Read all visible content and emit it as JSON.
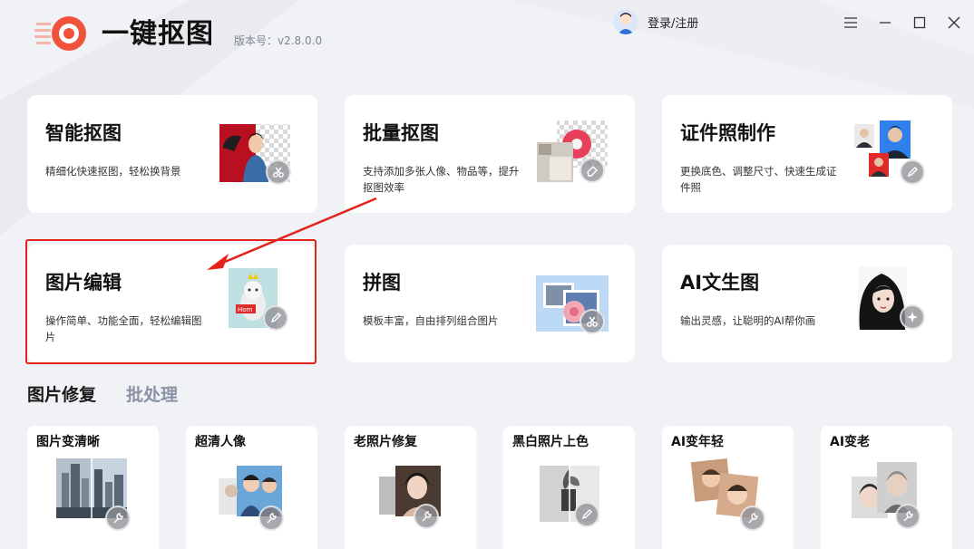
{
  "header": {
    "app_title": "一键抠图",
    "version": "版本号：v2.8.0.0",
    "login_label": "登录/注册",
    "window_controls": [
      "menu-icon",
      "minimize-icon",
      "maximize-icon",
      "close-icon"
    ]
  },
  "main_cards": [
    {
      "title": "智能抠图",
      "desc": "精细化快速抠图，轻松换背景"
    },
    {
      "title": "批量抠图",
      "desc": "支持添加多张人像、物品等，提升抠图效率"
    },
    {
      "title": "证件照制作",
      "desc": "更换底色、调整尺寸、快速生成证件照"
    },
    {
      "title": "图片编辑",
      "desc": "操作简单、功能全面，轻松编辑图片"
    },
    {
      "title": "拼图",
      "desc": "模板丰富，自由排列组合图片"
    },
    {
      "title": "AI文生图",
      "desc": "输出灵感，让聪明的AI帮你画"
    }
  ],
  "tabs": [
    {
      "label": "图片修复",
      "active": true
    },
    {
      "label": "批处理",
      "active": false
    }
  ],
  "repair_cards": [
    {
      "title": "图片变清晰"
    },
    {
      "title": "超清人像"
    },
    {
      "title": "老照片修复"
    },
    {
      "title": "黑白照片上色"
    },
    {
      "title": "AI变年轻"
    },
    {
      "title": "AI变老"
    }
  ],
  "colors": {
    "accent_red": "#e3231c",
    "logo_red": "#f0533a",
    "active_tab": "#1a1a1a",
    "inactive_tab": "#8a93a5",
    "background": "#f1f2f5"
  }
}
